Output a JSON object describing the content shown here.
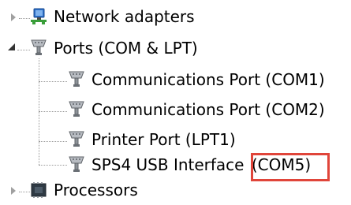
{
  "tree": {
    "items": [
      {
        "label": "Network adapters",
        "icon": "network-adapter-icon",
        "expanded": false,
        "level": 0
      },
      {
        "label": "Ports (COM & LPT)",
        "icon": "port-connector-icon",
        "expanded": true,
        "level": 0,
        "children": [
          {
            "label": "Communications Port (COM1)",
            "icon": "port-connector-icon"
          },
          {
            "label": "Communications Port (COM2)",
            "icon": "port-connector-icon"
          },
          {
            "label": "Printer Port (LPT1)",
            "icon": "port-connector-icon"
          },
          {
            "label_prefix": "SPS4 USB Interface ",
            "label_highlight": "(COM5)",
            "icon": "port-connector-icon",
            "highlight_color": "#e0453a"
          }
        ]
      },
      {
        "label": "Processors",
        "icon": "processor-icon",
        "expanded": false,
        "level": 0
      }
    ]
  }
}
